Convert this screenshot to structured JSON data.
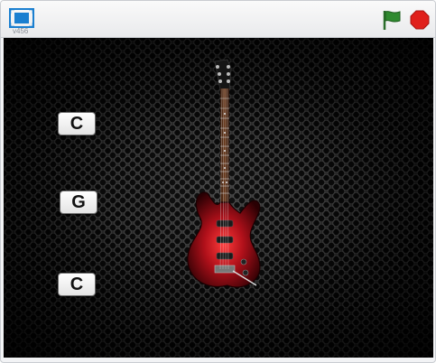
{
  "player": {
    "version": "v456",
    "icons": {
      "fullscreen": "fullscreen-icon",
      "green_flag": "green-flag-icon",
      "stop": "stop-sign-icon"
    },
    "colors": {
      "flag": "#2f8a2f",
      "stop": "#e0201b",
      "fullscreen": "#1a7fd0"
    }
  },
  "stage": {
    "sprite": "electric-guitar",
    "guitar_body_color": "#b0101a",
    "buttons": [
      {
        "label": "C"
      },
      {
        "label": "G"
      },
      {
        "label": "C"
      }
    ]
  }
}
